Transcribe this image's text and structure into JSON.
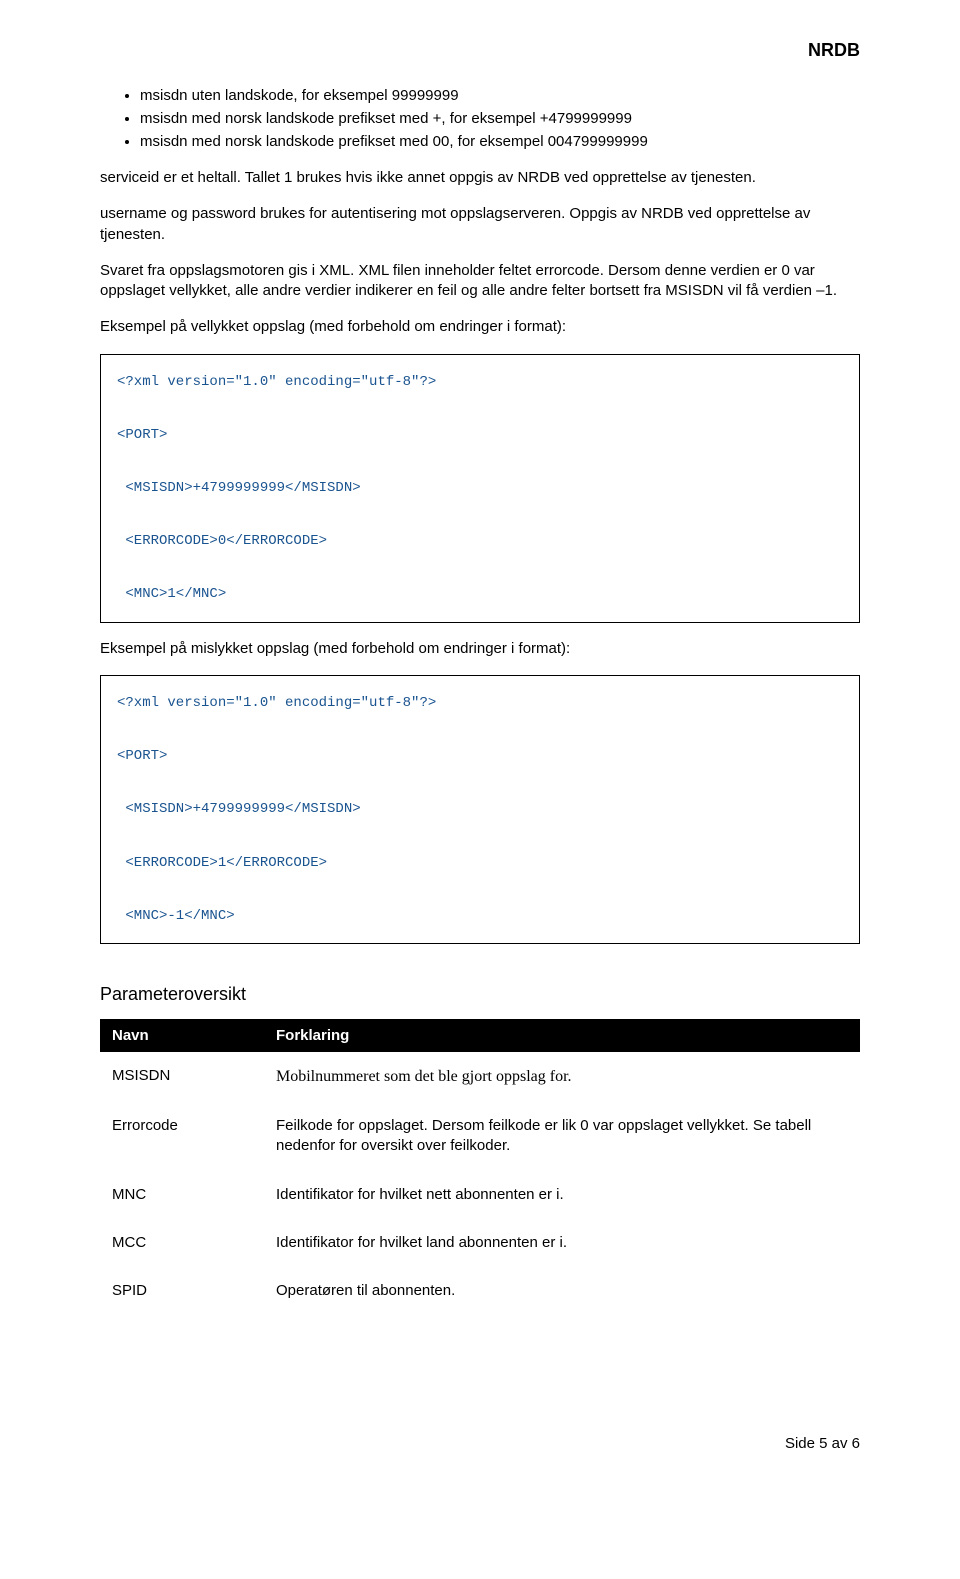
{
  "header": {
    "title": "NRDB"
  },
  "bullets": [
    "msisdn uten landskode, for eksempel 99999999",
    "msisdn med norsk landskode prefikset med +, for eksempel +4799999999",
    "msisdn med norsk landskode prefikset med 00, for eksempel 004799999999"
  ],
  "paragraphs": {
    "p1": "serviceid er et heltall. Tallet 1 brukes hvis ikke annet oppgis av NRDB ved opprettelse av tjenesten.",
    "p2": "username og password brukes for autentisering mot oppslagserveren. Oppgis av NRDB ved opprettelse av tjenesten.",
    "p3": "Svaret fra oppslagsmotoren gis i XML. XML filen inneholder feltet errorcode. Dersom denne verdien er 0 var oppslaget vellykket, alle andre verdier indikerer en feil og alle andre felter bortsett fra MSISDN vil få verdien –1.",
    "p4": "Eksempel på vellykket oppslag (med forbehold om endringer i format):",
    "p5": "Eksempel på mislykket oppslag (med forbehold om endringer i format):"
  },
  "code1": "<?xml version=\"1.0\" encoding=\"utf-8\"?>\n\n<PORT>\n\n <MSISDN>+4799999999</MSISDN>\n\n <ERRORCODE>0</ERRORCODE>\n\n <MNC>1</MNC>",
  "code2": "<?xml version=\"1.0\" encoding=\"utf-8\"?>\n\n<PORT>\n\n <MSISDN>+4799999999</MSISDN>\n\n <ERRORCODE>1</ERRORCODE>\n\n <MNC>-1</MNC>",
  "section_title": "Parameteroversikt",
  "table": {
    "headers": {
      "col1": "Navn",
      "col2": "Forklaring"
    },
    "rows": [
      {
        "name": "MSISDN",
        "desc": "Mobilnummeret som det ble gjort oppslag for.",
        "serif": true
      },
      {
        "name": "Errorcode",
        "desc": "Feilkode for oppslaget. Dersom feilkode er lik 0 var oppslaget vellykket. Se tabell nedenfor for oversikt over feilkoder.",
        "serif": false
      },
      {
        "name": "MNC",
        "desc": "Identifikator for hvilket nett abonnenten er i.",
        "serif": false
      },
      {
        "name": "MCC",
        "desc": "Identifikator for hvilket land abonnenten er i.",
        "serif": false
      },
      {
        "name": "SPID",
        "desc": "Operatøren til abonnenten.",
        "serif": false
      }
    ]
  },
  "footer": "Side 5 av 6"
}
